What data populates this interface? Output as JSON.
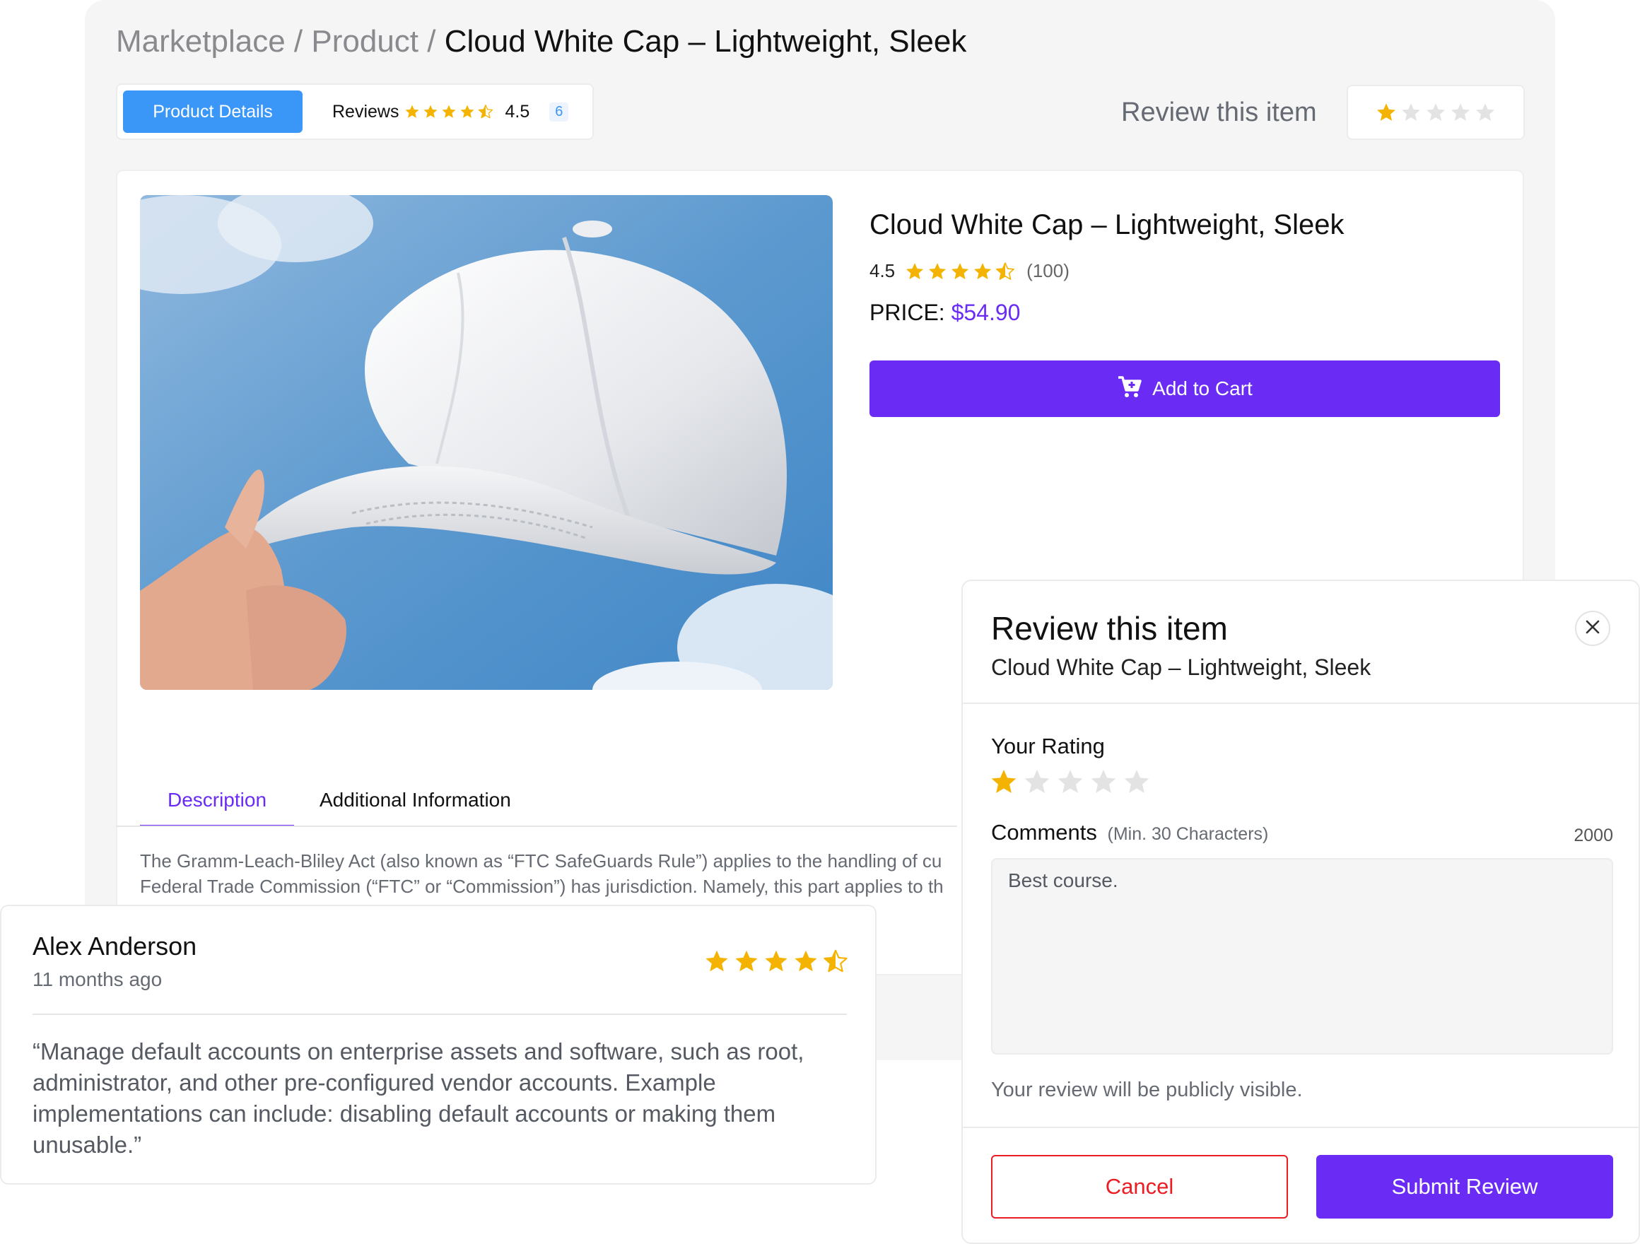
{
  "colors": {
    "accent": "#6a2cf5",
    "tab_active": "#3b97f7",
    "star": "#f5b301",
    "star_empty": "#e3e3e3",
    "cancel": "#ec1c24"
  },
  "breadcrumb": {
    "items": [
      "Marketplace",
      "Product"
    ],
    "separator": "/",
    "current": "Cloud White Cap – Lightweight, Sleek"
  },
  "tabs": {
    "details_label": "Product Details",
    "reviews_label": "Reviews",
    "reviews_rating": 4.5,
    "reviews_score": "4.5",
    "reviews_count": "6"
  },
  "review_item": {
    "label": "Review this item",
    "rating": 1
  },
  "product": {
    "image_icon": "white-cap-photo",
    "title": "Cloud White Cap – Lightweight, Sleek",
    "rating_text": "4.5",
    "rating": 4.5,
    "rating_count": "(100)",
    "price_label": "PRICE:",
    "price": "$54.90",
    "add_to_cart": "Add to Cart",
    "cart_icon": "cart-plus-icon"
  },
  "description": {
    "tab_description": "Description",
    "tab_additional": "Additional Information",
    "line1": "The Gramm-Leach-Bliley Act (also known as “FTC SafeGuards Rule”) applies to the handling of cu",
    "line2": "Federal Trade Commission (“FTC” or “Commission”) has jurisdiction. Namely, this part applies to th"
  },
  "review_card": {
    "name": "Alex Anderson",
    "time": "11 months ago",
    "rating": 4.5,
    "quote": "“Manage default accounts on enterprise assets and software, such as root, administrator, and other pre-configured vendor accounts. Example implementations can include: disabling default accounts or making them unusable.”"
  },
  "modal": {
    "title": "Review this item",
    "subtitle": "Cloud White Cap – Lightweight, Sleek",
    "close_icon": "close-icon",
    "rating_label": "Your Rating",
    "rating": 1,
    "comments_label": "Comments",
    "comments_hint": "(Min. 30 Characters)",
    "char_limit": "2000",
    "comment_value": "Best course.",
    "note": "Your review will be publicly visible.",
    "cancel": "Cancel",
    "submit": "Submit Review"
  }
}
